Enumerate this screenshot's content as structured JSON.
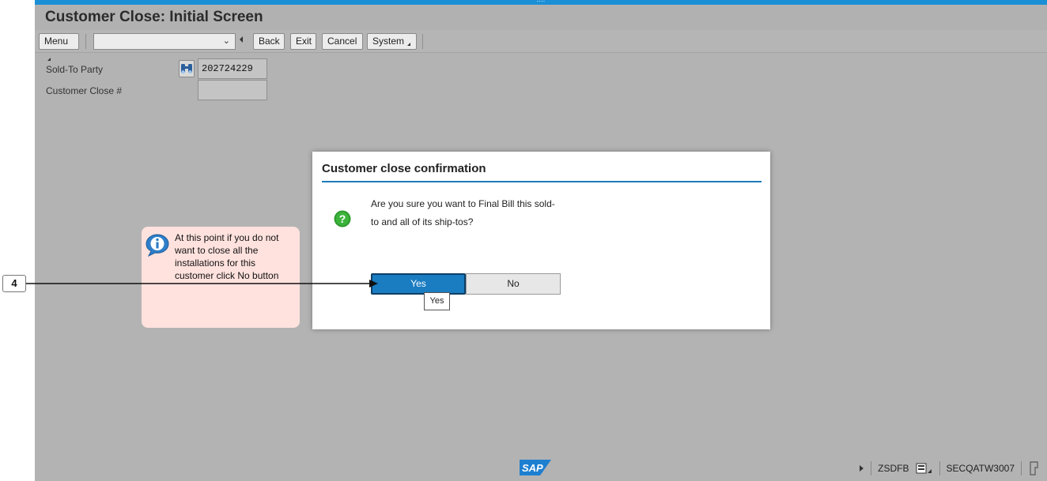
{
  "window": {
    "title": "Customer Close: Initial Screen"
  },
  "toolbar": {
    "menu_label": "Menu",
    "command_value": "",
    "back_label": "Back",
    "exit_label": "Exit",
    "cancel_label": "Cancel",
    "system_label": "System"
  },
  "form": {
    "sold_to_label": "Sold-To Party",
    "sold_to_value": "202724229",
    "close_label": "Customer Close #",
    "close_value": ""
  },
  "dialog": {
    "title": "Customer close confirmation",
    "message_line1": "Are you sure you want to Final Bill this sold-",
    "message_line2": "to and all of its ship-tos?",
    "yes_label": "Yes",
    "no_label": "No",
    "tooltip": "Yes",
    "icon": "question-icon"
  },
  "callout": {
    "text": "At this point if you do not want to close all the installations for this customer click No button",
    "icon": "info-icon"
  },
  "step": {
    "number": "4"
  },
  "statusbar": {
    "transaction": "ZSDFB",
    "system": "SECQATW3007",
    "logo_text": "SAP"
  },
  "colors": {
    "accent": "#1b8fd6",
    "primary_button": "#1a7cc1",
    "background": "#b3b3b3",
    "callout": "#ffe2de",
    "question_icon": "#2e9a2e"
  }
}
